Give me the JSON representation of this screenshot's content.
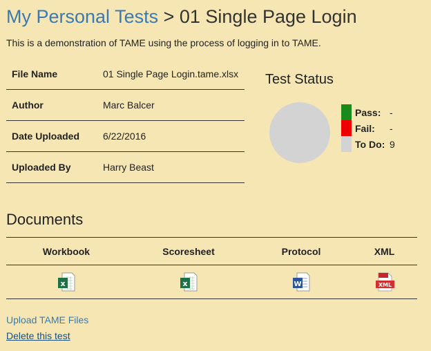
{
  "breadcrumb": {
    "parent": "My Personal Tests",
    "separator": " > ",
    "current": "01 Single Page Login"
  },
  "description": "This is a demonstration of TAME using the process of logging in to TAME.",
  "info": [
    {
      "label": "File Name",
      "value": "01 Single Page Login.tame.xlsx"
    },
    {
      "label": "Author",
      "value": "Marc Balcer"
    },
    {
      "label": "Date Uploaded",
      "value": "6/22/2016"
    },
    {
      "label": "Uploaded By",
      "value": "Harry Beast"
    }
  ],
  "test_status": {
    "title": "Test Status",
    "legend": [
      {
        "label": "Pass:",
        "value": "-",
        "color": "#1a8a1a"
      },
      {
        "label": "Fail:",
        "value": "-",
        "color": "#ee0000"
      },
      {
        "label": "To Do:",
        "value": "9",
        "color": "#d3d3d3"
      }
    ],
    "pie_color": "#d3d3d3"
  },
  "documents": {
    "title": "Documents",
    "columns": [
      "Workbook",
      "Scoresheet",
      "Protocol",
      "XML"
    ],
    "icons": [
      "excel-file-icon",
      "excel-file-icon",
      "word-file-icon",
      "xml-file-icon"
    ],
    "xml_badge": "XML"
  },
  "links": {
    "upload": "Upload TAME Files",
    "delete": "Delete this test"
  },
  "colors": {
    "background": "#f5e6b3",
    "link": "#3a7ab3"
  }
}
